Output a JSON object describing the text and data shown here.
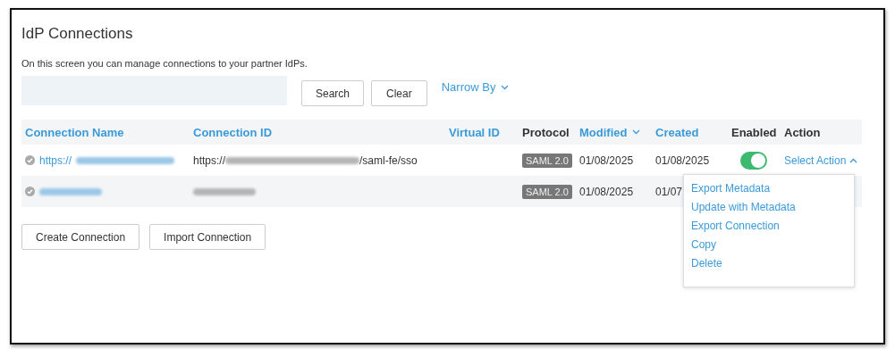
{
  "title": "IdP Connections",
  "description": "On this screen you can manage connections to your partner IdPs.",
  "search": {
    "buttons": [
      "Search",
      "Clear"
    ],
    "narrow_by": "Narrow By"
  },
  "table": {
    "columns": [
      {
        "label": "Connection Name",
        "sortable": true,
        "sorted": false
      },
      {
        "label": "Connection ID",
        "sortable": true,
        "sorted": false
      },
      {
        "label": "Virtual ID",
        "sortable": true,
        "sorted": false
      },
      {
        "label": "Protocol",
        "sortable": false,
        "sorted": false
      },
      {
        "label": "Modified",
        "sortable": true,
        "sorted": true
      },
      {
        "label": "Created",
        "sortable": true,
        "sorted": false
      },
      {
        "label": "Enabled",
        "sortable": false,
        "sorted": false
      },
      {
        "label": "Action",
        "sortable": false,
        "sorted": false
      }
    ],
    "rows": [
      {
        "name": {
          "text": "https://",
          "redacted": true
        },
        "connection_id": {
          "text": "https://",
          "redacted": true,
          "suffix": "/saml-fe/sso"
        },
        "protocol": "SAML 2.0",
        "modified": "01/08/2025",
        "created": "01/08/2025",
        "enabled": true,
        "action": {
          "label": "Select Action",
          "expanded": true,
          "menu": [
            "Export Metadata",
            "Update with Metadata",
            "Export Connection",
            "Copy",
            "Delete"
          ]
        }
      },
      {
        "name": {
          "redacted": true
        },
        "connection_id": {
          "redacted": true
        },
        "protocol": "SAML 2.0",
        "modified": "01/08/2025",
        "created": "01/07"
      }
    ]
  },
  "buttons": [
    "Create Connection",
    "Import Connection"
  ]
}
